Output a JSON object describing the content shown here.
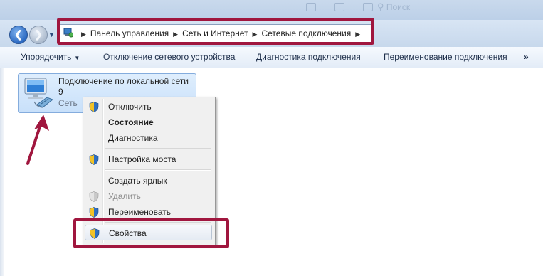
{
  "window": {
    "search_ghost": "Поиск"
  },
  "navigation": {
    "back_icon": "back-arrow-icon",
    "forward_icon": "forward-arrow-icon",
    "history_icon": "chevron-down-icon"
  },
  "address_bar": {
    "icon": "control-panel-icon",
    "crumbs": [
      "Панель управления",
      "Сеть и Интернет",
      "Сетевые подключения"
    ]
  },
  "toolbar": {
    "organize_label": "Упорядочить",
    "disable_label": "Отключение сетевого устройства",
    "diagnose_label": "Диагностика подключения",
    "rename_label": "Переименование подключения",
    "more_label": "»"
  },
  "connection": {
    "name_line1": "Подключение по локальной сети",
    "name_line2": "9",
    "status": "Сеть",
    "icon": "network-adapter-icon"
  },
  "context_menu": {
    "items": [
      {
        "label": "Отключить",
        "shield": true
      },
      {
        "label": "Состояние",
        "shield": false
      },
      {
        "label": "Диагностика",
        "shield": false
      },
      {
        "label": "Настройка моста",
        "shield": true
      },
      {
        "label": "Создать ярлык",
        "shield": false
      },
      {
        "label": "Удалить",
        "shield": true
      },
      {
        "label": "Переименовать",
        "shield": true
      },
      {
        "label": "Свойства",
        "shield": true
      }
    ]
  },
  "colors": {
    "highlight": "#a0163e",
    "selection": "#c8e0fa",
    "toolbar_text": "#1e2f4b"
  }
}
